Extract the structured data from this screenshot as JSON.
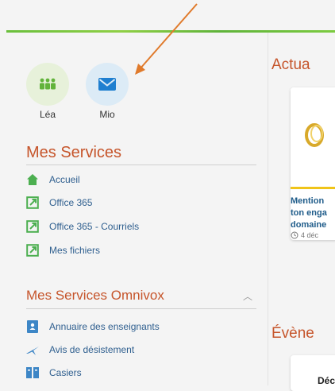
{
  "apps": [
    {
      "label": "Léa",
      "icon": "people-group-icon"
    },
    {
      "label": "Mio",
      "icon": "envelope-icon"
    }
  ],
  "services": {
    "title": "Mes Services",
    "items": [
      {
        "label": "Accueil",
        "icon": "home-icon"
      },
      {
        "label": "Office 365",
        "icon": "external-link-icon"
      },
      {
        "label": "Office 365 - Courriels",
        "icon": "external-link-icon"
      },
      {
        "label": "Mes fichiers",
        "icon": "external-link-icon"
      }
    ]
  },
  "omnivox": {
    "title": "Mes Services Omnivox",
    "collapse_icon": "chevron-up-icon",
    "items": [
      {
        "label": "Annuaire des enseignants",
        "icon": "directory-icon"
      },
      {
        "label": "Avis de désistement",
        "icon": "plane-icon"
      },
      {
        "label": "Casiers",
        "icon": "locker-icon"
      }
    ]
  },
  "news": {
    "title": "Actua",
    "card_lines": [
      "Mention",
      "ton enga",
      "domaine"
    ],
    "card_date": "4 déc"
  },
  "events": {
    "title": "Évène",
    "card_title": "Déc"
  },
  "colors": {
    "accent_orange": "#c6552b",
    "link_blue": "#2f5f8f",
    "green": "#62b33b",
    "annotation_arrow": "#e07a2b"
  }
}
